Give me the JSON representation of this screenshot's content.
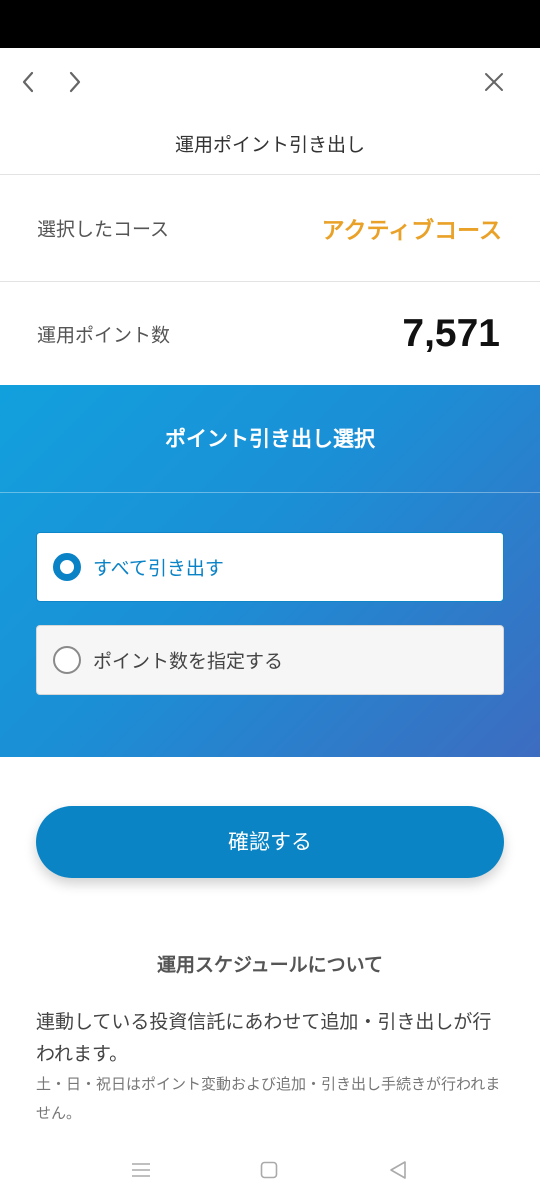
{
  "header": {
    "title": "運用ポイント引き出し"
  },
  "nav_icons": {
    "back": "chevron-left-icon",
    "forward": "chevron-right-icon",
    "close": "close-icon"
  },
  "course": {
    "label": "選択したコース",
    "value": "アクティブコース",
    "value_color": "#e9a127"
  },
  "points": {
    "label": "運用ポイント数",
    "value": "7,571"
  },
  "selection": {
    "title": "ポイント引き出し選択",
    "options": [
      {
        "label": "すべて引き出す",
        "selected": true
      },
      {
        "label": "ポイント数を指定する",
        "selected": false
      }
    ],
    "accent_color": "#0a82c6"
  },
  "confirm": {
    "label": "確認する"
  },
  "schedule": {
    "title": "運用スケジュールについて",
    "text": "連動している投資信託にあわせて追加・引き出しが行われます。",
    "note": "土・日・祝日はポイント変動および追加・引き出し手続きが行われません。"
  },
  "system_nav": {
    "menu": "menu-icon",
    "home": "home-icon",
    "back": "back-triangle-icon"
  }
}
